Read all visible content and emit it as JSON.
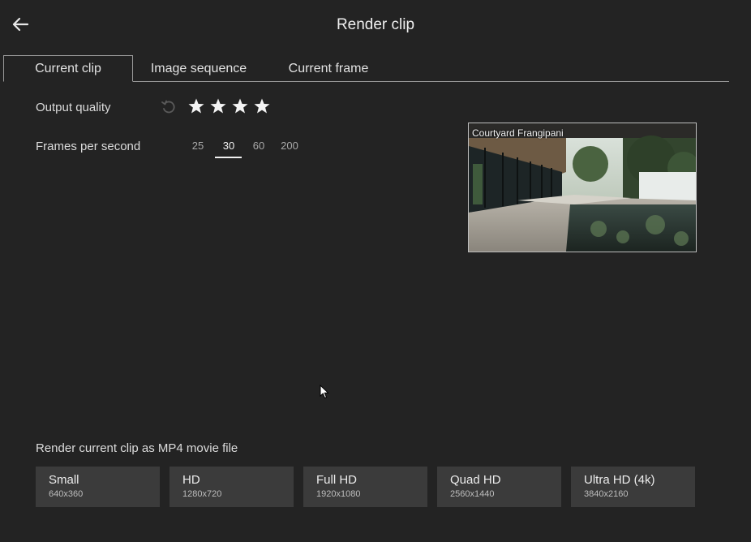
{
  "header": {
    "title": "Render clip",
    "back_icon": "arrow-left-icon"
  },
  "tabs": [
    {
      "label": "Current clip",
      "active": true
    },
    {
      "label": "Image sequence",
      "active": false
    },
    {
      "label": "Current frame",
      "active": false
    }
  ],
  "settings": {
    "output_quality_label": "Output quality",
    "output_quality_stars": 4,
    "reset_icon": "reset-icon",
    "fps_label": "Frames per second",
    "fps_options": [
      "25",
      "30",
      "60",
      "200"
    ],
    "fps_selected": "30"
  },
  "preview": {
    "title": "Courtyard Frangipani"
  },
  "render": {
    "label": "Render current clip as MP4 movie file",
    "options": [
      {
        "name": "Small",
        "dims": "640x360"
      },
      {
        "name": "HD",
        "dims": "1280x720"
      },
      {
        "name": "Full HD",
        "dims": "1920x1080"
      },
      {
        "name": "Quad HD",
        "dims": "2560x1440"
      },
      {
        "name": "Ultra HD (4k)",
        "dims": "3840x2160"
      }
    ]
  },
  "colors": {
    "background": "#232323",
    "button": "#3b3b3b",
    "text": "#e6e6e6"
  }
}
